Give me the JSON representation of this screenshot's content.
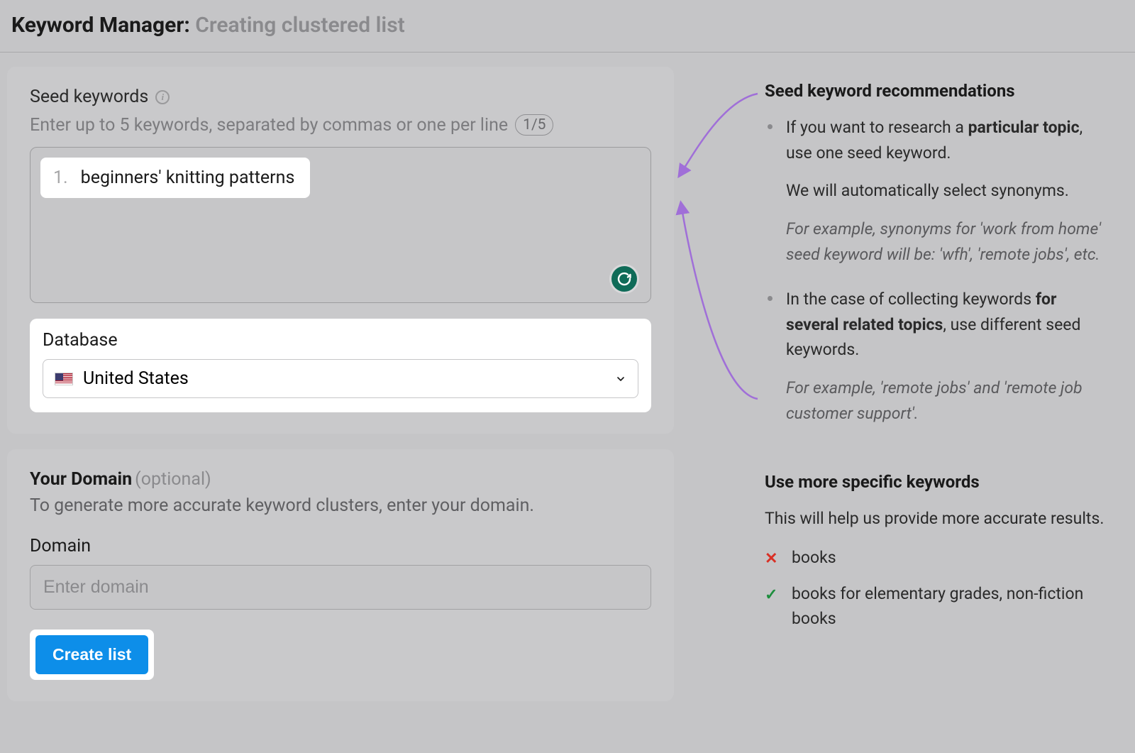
{
  "header": {
    "title_main": "Keyword Manager:",
    "title_sub": "Creating clustered list"
  },
  "seed": {
    "label": "Seed keywords",
    "help": "Enter up to 5 keywords, separated by commas or one per line",
    "counter": "1/5",
    "keyword_num": "1.",
    "keyword_value": "beginners' knitting patterns"
  },
  "database": {
    "label": "Database",
    "selected": "United States"
  },
  "domain": {
    "headline": "Your Domain",
    "optional": "(optional)",
    "desc": "To generate more accurate keyword clusters, enter your domain.",
    "field_label": "Domain",
    "placeholder": "Enter domain"
  },
  "actions": {
    "create": "Create list"
  },
  "recs": {
    "title": "Seed keyword recommendations",
    "item1_pre": "If you want to research a ",
    "item1_strong": "particular topic",
    "item1_post": ", use one seed keyword.",
    "item1_sub1": "We will automatically select synonyms.",
    "item1_sub2": "For example, synonyms for 'work from home' seed keyword will be: 'wfh', 'remote jobs', etc.",
    "item2_pre": "In the case of collecting keywords ",
    "item2_strong": "for several related topics",
    "item2_post": ", use different seed keywords.",
    "item2_sub1": "For example, 'remote jobs' and 'remote job customer support'."
  },
  "specific": {
    "title": "Use more specific keywords",
    "desc": "This will help us provide more accurate results.",
    "bad": "books",
    "good": "books for elementary grades, non-fiction books"
  }
}
